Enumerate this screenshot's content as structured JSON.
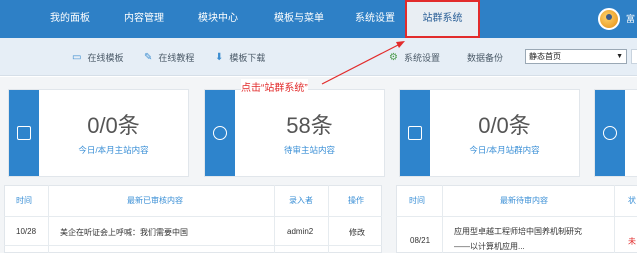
{
  "nav": {
    "items": [
      "我的面板",
      "内容管理",
      "模块中心",
      "模板与菜单",
      "系统设置",
      "站群系统"
    ],
    "user_name": "富"
  },
  "toolbar": {
    "online_template": "在线模板",
    "online_tutorial": "在线教程",
    "template_download": "模板下载",
    "system_settings": "系统设置",
    "data_backup": "数据备份",
    "homepage_select_value": "静态首页"
  },
  "annotation": {
    "text": "点击“站群系统”"
  },
  "stats": [
    {
      "value": "0/0条",
      "label": "今日/本月主站内容"
    },
    {
      "value": "58条",
      "label": "待审主站内容"
    },
    {
      "value": "0/0条",
      "label": "今日/本月站群内容"
    }
  ],
  "reviewed_table": {
    "headers": {
      "time": "时间",
      "content": "最新已审核内容",
      "author": "录入者",
      "action": "操作"
    },
    "rows": [
      {
        "time": "10/28",
        "content": "美企在听证会上呼喊：我们需要中国",
        "author": "admin2",
        "action": "修改"
      }
    ]
  },
  "pending_table": {
    "headers": {
      "time": "时间",
      "content": "最新待审内容",
      "extra": "状"
    },
    "rows": [
      {
        "time": "08/21",
        "content_line1": "应用型卓越工程师培中国养机制研究",
        "content_line2": "——以计算机应用...",
        "extra": "未"
      }
    ]
  },
  "colors": {
    "nav_bg": "#2e80c6",
    "accent": "#3a8fd6",
    "annotation_red": "#e22b2b"
  }
}
